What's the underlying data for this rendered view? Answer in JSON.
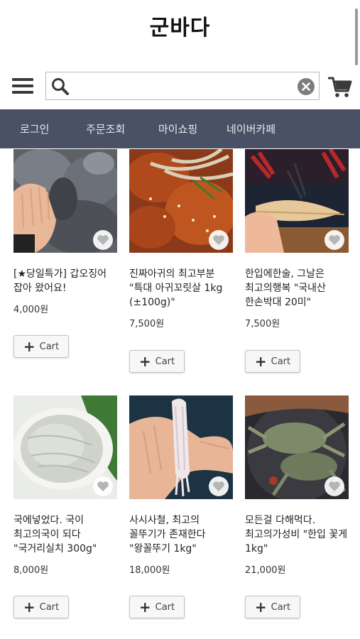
{
  "header": {
    "title": "군바다"
  },
  "search": {
    "value": "",
    "placeholder": ""
  },
  "nav": {
    "items": [
      "로그인",
      "주문조회",
      "마이쇼핑",
      "네이버카페"
    ]
  },
  "icons": {
    "menu": "hamburger-menu-icon",
    "search": "search-icon",
    "clear": "clear-icon",
    "cart": "cart-icon",
    "heart": "heart-icon"
  },
  "colors": {
    "nav_bg": "#4a5164",
    "nav_text": "#e6e8ee"
  },
  "products": [
    {
      "name": "[★당일특가] 갑오징어 잡아 왔어요!",
      "price": "4,000원",
      "cart_label": "Cart"
    },
    {
      "name": "진짜아귀의 최고부분 \"특대 아귀꼬릿살 1kg (±100g)\"",
      "price": "7,500원",
      "cart_label": "Cart"
    },
    {
      "name": "한입에한술, 그날은 최고의행복 \"국내산 한손박대 20미\"",
      "price": "7,500원",
      "cart_label": "Cart"
    },
    {
      "name": "국에넣었다. 국이 최고의국이 되다 \"국거리실치 300g\"",
      "price": "8,000원",
      "cart_label": "Cart"
    },
    {
      "name": "사시사철, 최고의 꼴뚜기가 존재한다 \"왕꼴뚜기 1kg\"",
      "price": "18,000원",
      "cart_label": "Cart"
    },
    {
      "name": "모든걸 다해먹다. 최고의가성비 \"한입 꽃게 1kg\"",
      "price": "21,000원",
      "cart_label": "Cart"
    }
  ]
}
